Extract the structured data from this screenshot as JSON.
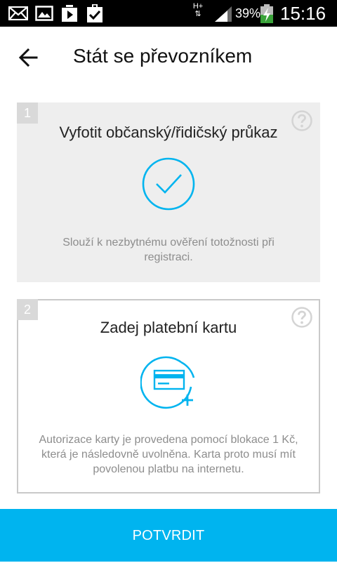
{
  "status_bar": {
    "icons": [
      "mail-icon",
      "image-icon",
      "play-store-icon",
      "clipboard-check-icon",
      "network-h-plus-icon",
      "signal-icon",
      "battery-charging-icon"
    ],
    "network_type": "H+",
    "battery_percent": "39%",
    "time": "15:16"
  },
  "header": {
    "back_icon": "arrow-left-icon",
    "title": "Stát se převozníkem"
  },
  "steps": [
    {
      "number": "1",
      "title": "Vyfotit občanský/řidičský průkaz",
      "status": "completed",
      "icon": "check-circle-icon",
      "help_icon": "question-circle-icon",
      "description": "Slouží k nezbytnému ověření totožnosti při registraci."
    },
    {
      "number": "2",
      "title": "Zadej platební kartu",
      "status": "pending",
      "icon": "add-card-icon",
      "help_icon": "question-circle-icon",
      "description": "Autorizace karty je provedena pomocí blokace 1 Kč, která je následovně uvolněna. Karta proto musí mít povolenou platbu na internetu."
    }
  ],
  "confirm_button": {
    "label": "POTVRDIT"
  },
  "colors": {
    "accent": "#00b4ef",
    "completed_card_bg": "#eeeeee",
    "badge": "#d9d9d9",
    "muted_text": "#8d8d8d"
  }
}
